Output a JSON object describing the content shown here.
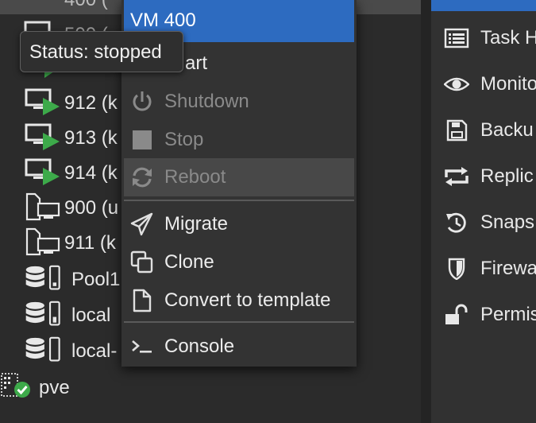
{
  "tree": {
    "top_row": "400 (",
    "rows": [
      {
        "label": "500 (",
        "kind": "vm-running"
      },
      {
        "label": "",
        "kind": "vm-running"
      },
      {
        "label": "912 (k",
        "kind": "vm-running"
      },
      {
        "label": "913 (k",
        "kind": "vm-running"
      },
      {
        "label": "914 (k",
        "kind": "vm-running"
      },
      {
        "label": "900 (u",
        "kind": "template"
      },
      {
        "label": "911 (k",
        "kind": "template"
      },
      {
        "label": "Pool1",
        "kind": "storage"
      },
      {
        "label": "local",
        "kind": "storage"
      },
      {
        "label": "local-",
        "kind": "storage"
      },
      {
        "label": "pve",
        "kind": "node"
      }
    ]
  },
  "tooltip": {
    "text": "Status: stopped"
  },
  "context_menu": {
    "title": "VM 400",
    "items": [
      {
        "label": "Start",
        "visible_text": "art",
        "icon": "play-icon",
        "enabled": true
      },
      {
        "label": "Shutdown",
        "icon": "power-icon",
        "enabled": false
      },
      {
        "label": "Stop",
        "icon": "stop-icon",
        "enabled": false
      },
      {
        "label": "Reboot",
        "icon": "refresh-icon",
        "enabled": false
      },
      {
        "label": "Migrate",
        "icon": "paper-plane-icon",
        "enabled": true
      },
      {
        "label": "Clone",
        "icon": "clone-icon",
        "enabled": true
      },
      {
        "label": "Convert to template",
        "icon": "file-icon",
        "enabled": true
      },
      {
        "label": "Console",
        "icon": "terminal-icon",
        "enabled": true
      }
    ]
  },
  "right_menu": {
    "items": [
      {
        "label": "Task H",
        "icon": "list-icon"
      },
      {
        "label": "Monito",
        "icon": "eye-icon"
      },
      {
        "label": "Backu",
        "icon": "floppy-icon"
      },
      {
        "label": "Replic",
        "icon": "retweet-icon"
      },
      {
        "label": "Snaps",
        "icon": "history-icon"
      },
      {
        "label": "Firewa",
        "icon": "shield-icon"
      },
      {
        "label": "Permis",
        "icon": "unlock-icon"
      }
    ]
  },
  "colors": {
    "accent": "#2d6bc0",
    "running": "#3daa4a",
    "node_ok": "#3daa4a"
  }
}
